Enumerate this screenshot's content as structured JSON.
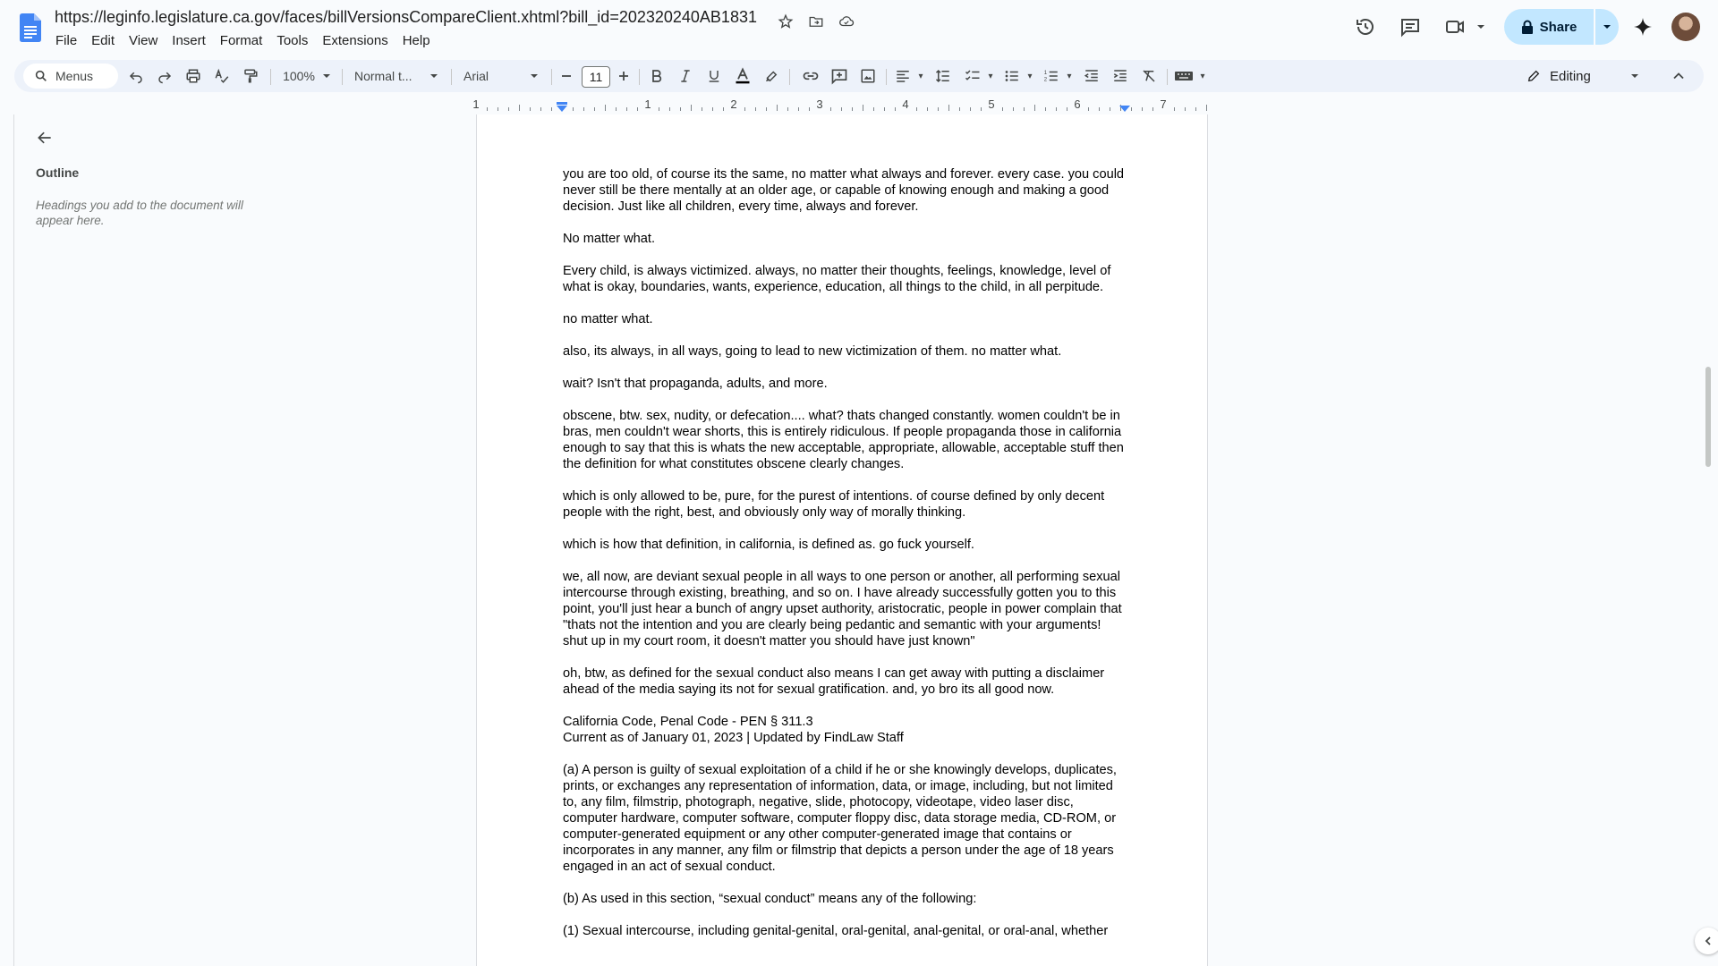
{
  "window": {
    "doc_title": "https://leginfo.legislature.ca.gov/faces/billVersionsCompareClient.xhtml?bill_id=202320240AB1831"
  },
  "menubar": [
    "File",
    "Edit",
    "View",
    "Insert",
    "Format",
    "Tools",
    "Extensions",
    "Help"
  ],
  "header_actions": {
    "share_label": "Share"
  },
  "toolbar": {
    "search_label": "Menus",
    "zoom": "100%",
    "style": "Normal t...",
    "font": "Arial",
    "font_size": "11",
    "mode": "Editing"
  },
  "ruler": {
    "labels": [
      "1",
      "1",
      "2",
      "3",
      "4",
      "5",
      "6",
      "7"
    ]
  },
  "outline": {
    "title": "Outline",
    "hint": "Headings you add to the document will appear here."
  },
  "document": {
    "paragraphs": [
      "you are too old, of course its the same, no matter what always and forever. every case. you could never still be there mentally at an older age, or capable of knowing enough and making a good decision. Just like all children, every time, always and forever.",
      "No matter what.",
      "Every child, is always victimized. always, no matter their thoughts, feelings, knowledge, level of what is okay, boundaries, wants, experience, education, all things to the child, in all perpitude.",
      "no matter what.",
      "also, its always, in all ways, going to lead to new victimization of them. no matter what.",
      "wait? Isn't that propaganda, adults, and more.",
      "obscene, btw. sex, nudity, or defecation.... what? thats changed constantly. women couldn't be in bras, men couldn't wear shorts, this is entirely ridiculous. If people propaganda those in california enough to say that this is whats the new acceptable, appropriate, allowable, acceptable stuff then the definition for what constitutes obscene clearly changes.",
      "which is only allowed to be, pure, for the purest of intentions. of course defined by only decent people with the right, best, and obviously only way of morally thinking.",
      "which is how that definition, in california, is defined as. go fuck yourself.",
      "we, all now, are deviant sexual people in all ways to one person or another, all performing sexual intercourse through existing, breathing, and so on. I have already successfully gotten you to this point, you'll just hear a bunch of angry upset authority, aristocratic, people in power complain that \"thats not the intention and you are clearly being pedantic and semantic with your arguments! shut up in my court room, it doesn't matter you should have just known\"",
      "oh, btw, as defined for the sexual conduct also means I can get away with putting a disclaimer ahead of the media saying its not for sexual gratification. and, yo bro its all good now.",
      "California Code, Penal Code - PEN § 311.3\nCurrent as of January 01, 2023 | Updated by FindLaw Staff",
      "(a) A person is guilty of sexual exploitation of a child if he or she knowingly develops, duplicates, prints, or exchanges any representation of information, data, or image, including, but not limited to, any film, filmstrip, photograph, negative, slide, photocopy, videotape, video laser disc, computer hardware, computer software, computer floppy disc, data storage media, CD-ROM, or computer-generated equipment or any other computer-generated image that contains or incorporates in any manner, any film or filmstrip that depicts a person under the age of 18 years engaged in an act of sexual conduct.",
      "(b) As used in this section, “sexual conduct” means any of the following:",
      "(1) Sexual intercourse, including genital-genital, oral-genital, anal-genital, or oral-anal, whether"
    ]
  },
  "colors": {
    "accent": "#c2e7ff",
    "toolbar_bg": "#edf2fa",
    "doc_blue": "#4285f4"
  }
}
